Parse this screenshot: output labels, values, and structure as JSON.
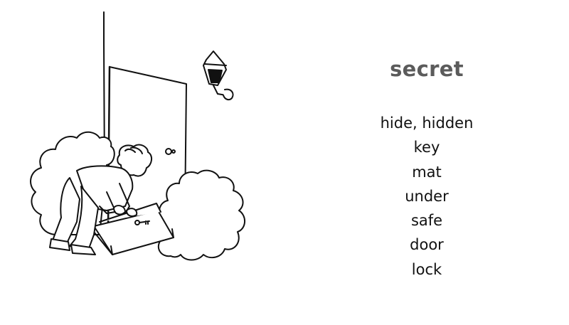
{
  "title": "secret",
  "words": [
    "hide, hidden",
    "key",
    "mat",
    "under",
    "safe",
    "door",
    "lock"
  ],
  "illustration": {
    "description_icons": [
      "door-icon",
      "wall-lamp-icon",
      "bush-icon",
      "person-icon",
      "doormat-icon",
      "key-icon"
    ],
    "stroke_color": "#111111",
    "fill_color": "#ffffff"
  },
  "colors": {
    "title": "#5b5b5b",
    "text": "#111111",
    "background": "#ffffff"
  }
}
